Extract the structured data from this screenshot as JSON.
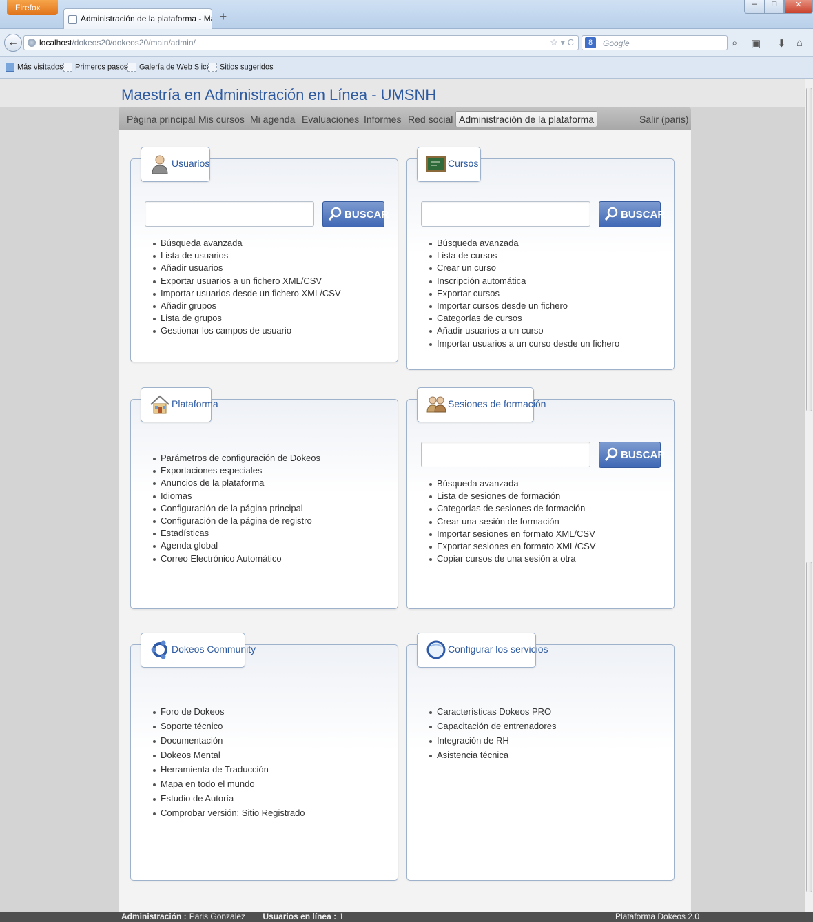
{
  "browser": {
    "menu_button": "Firefox",
    "tab_title": "Administración de la plataforma - Maest...",
    "url_host": "localhost",
    "url_path": "/dokeos20/dokeos20/main/admin/",
    "search_placeholder": "Google",
    "bookmarks": [
      "Más visitados",
      "Primeros pasos",
      "Galería de Web Slice",
      "Sitios sugeridos"
    ]
  },
  "site": {
    "title": "Maestría en Administración en Línea - UMSNH",
    "menu": [
      "Página principal",
      "Mis cursos",
      "Mi agenda",
      "Evaluaciones",
      "Informes",
      "Red social",
      "Administración de la plataforma"
    ],
    "logout": "Salir (paris)"
  },
  "panels": {
    "usuarios": {
      "title": "Usuarios",
      "search_button": "BUSCAR",
      "links": [
        "Búsqueda avanzada",
        "Lista de usuarios",
        "Añadir usuarios",
        "Exportar usuarios a un fichero XML/CSV",
        "Importar usuarios desde un fichero XML/CSV",
        "Añadir grupos",
        "Lista de grupos",
        "Gestionar los campos de usuario"
      ]
    },
    "cursos": {
      "title": "Cursos",
      "search_button": "BUSCAR",
      "links": [
        "Búsqueda avanzada",
        "Lista de cursos",
        "Crear un curso",
        "Inscripción automática",
        "Exportar cursos",
        "Importar cursos desde un fichero",
        "Categorías de cursos",
        "Añadir usuarios a un curso",
        "Importar usuarios a un curso desde un fichero"
      ]
    },
    "plataforma": {
      "title": "Plataforma",
      "links": [
        "Parámetros de configuración de Dokeos",
        "Exportaciones especiales",
        "Anuncios de la plataforma",
        "Idiomas",
        "Configuración de la página principal",
        "Configuración de la página de registro",
        "Estadísticas",
        "Agenda global",
        "Correo Electrónico Automático"
      ]
    },
    "sesiones": {
      "title": "Sesiones de formación",
      "search_button": "BUSCAR",
      "links": [
        "Búsqueda avanzada",
        "Lista de sesiones de formación",
        "Categorías de sesiones de formación",
        "Crear una sesión de formación",
        "Importar sesiones en formato XML/CSV",
        "Exportar sesiones en formato XML/CSV",
        "Copiar cursos de una sesión a otra"
      ]
    },
    "community": {
      "title": "Dokeos Community",
      "links": [
        "Foro de Dokeos",
        "Soporte técnico",
        "Documentación",
        "Dokeos Mental",
        "Herramienta de Traducción",
        "Mapa en todo el mundo",
        "Estudio de Autoría",
        "Comprobar versión: Sitio Registrado"
      ]
    },
    "servicios": {
      "title": "Configurar los servicios",
      "links": [
        "Características Dokeos PRO",
        "Capacitación de entrenadores",
        "Integración de RH",
        "Asistencia técnica"
      ]
    }
  },
  "footer": {
    "admin_label": "Administración :",
    "admin_name": "Paris Gonzalez",
    "online_label": "Usuarios en línea :",
    "online_count": "1",
    "platform": "Plataforma Dokeos 2.0"
  },
  "colors": {
    "accent": "#2d5aa0",
    "button": "#3f68b5",
    "footer": "#4f4f4f"
  },
  "icons": [
    "user-icon",
    "chalkboard-icon",
    "house-icon",
    "people-icon",
    "community-icon",
    "services-globe-icon",
    "magnifier-icon"
  ]
}
